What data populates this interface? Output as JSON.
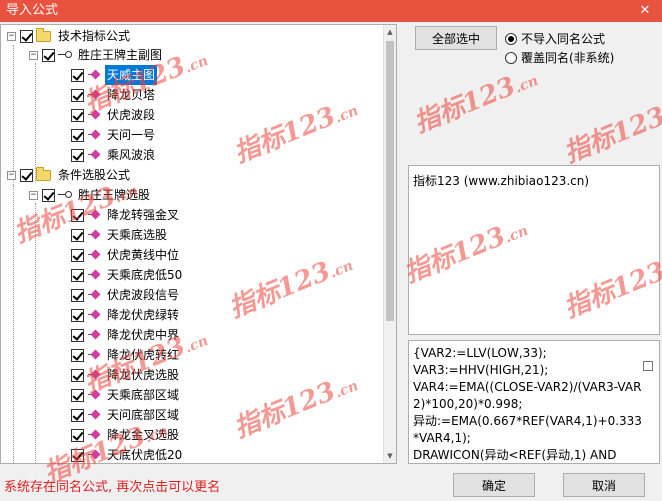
{
  "window": {
    "title": "导入公式",
    "close_glyph": "✕"
  },
  "tree": {
    "groups": [
      {
        "label": "技术指标公式",
        "sub": {
          "label": "胜庄王牌主副图",
          "items": [
            "天威主图",
            "降龙贝塔",
            "伏虎波段",
            "天问一号",
            "乘风波浪"
          ]
        }
      },
      {
        "label": "条件选股公式",
        "sub": {
          "label": "胜庄王牌选股",
          "items": [
            "降龙转强金叉",
            "天乘底选股",
            "伏虎黄线中位",
            "天乘底虎低50",
            "伏虎波段信号",
            "降龙伏虎绿转",
            "降龙伏虎中界",
            "降龙伏虎转红",
            "降龙伏虎选股",
            "天乘底部区域",
            "天问底部区域",
            "降龙金叉选股",
            "天底伏虎低20"
          ]
        }
      }
    ],
    "selected_item": "天威主图",
    "expanded_glyph": "−"
  },
  "scrollbar": {
    "up_glyph": "▲",
    "down_glyph": "▼"
  },
  "actions": {
    "select_all_label": "全部选中",
    "ok_label": "确定",
    "cancel_label": "取消"
  },
  "options": [
    {
      "label": "不导入同名公式",
      "selected": true
    },
    {
      "label": "覆盖同名(非系统)",
      "selected": false
    }
  ],
  "description": "指标123   (www.zhibiao123.cn)",
  "code_lines": [
    "{VAR2:=LLV(LOW,33);",
    "VAR3:=HHV(HIGH,21);",
    "VAR4:=EMA((CLOSE-VAR2)/(VAR3-VAR2)*100,20)*0.998;",
    "异动:=EMA(0.667*REF(VAR4,1)+0.333*VAR4,1);",
    "DRAWICON(异动<REF(异动,1) AND"
  ],
  "status": "系统存在同名公式, 再次点击可以更名",
  "watermark": {
    "main": "指标123",
    "suffix": ".cn"
  },
  "colors": {
    "title_bar": "#e8523f",
    "selection": "#0078d7",
    "status_text": "#e02020",
    "formula_icon": "#d23ca0"
  }
}
